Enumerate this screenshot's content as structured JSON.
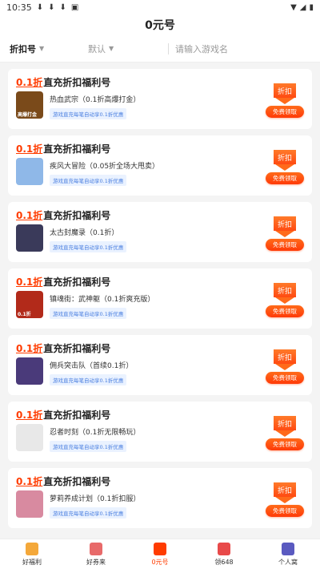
{
  "statusbar": {
    "time": "10:35"
  },
  "header": {
    "title": "0元号"
  },
  "filters": {
    "sort": "折扣号",
    "default": "默认",
    "search_placeholder": "请输入游戏名"
  },
  "card_common": {
    "disc": "0.1折",
    "title_rest": "直充折扣福利号",
    "tag": "游戏直充每笔自动享0.1折优惠",
    "badge": "折扣",
    "claim": "免费领取"
  },
  "cards": [
    {
      "name": "热血武宗（0.1折高爆打金）",
      "thumb_label": "高爆打金",
      "color": "#7a4a1a"
    },
    {
      "name": "疾风大冒险（0.05折全场大甩卖）",
      "thumb_label": "",
      "color": "#8fb8e8"
    },
    {
      "name": "太古封魔录（0.1折）",
      "thumb_label": "",
      "color": "#3a3a5a"
    },
    {
      "name": "镇魂街：武神躯（0.1折爽充版）",
      "thumb_label": "0.1折",
      "color": "#b22a1a"
    },
    {
      "name": "佣兵突击队（首续0.1折）",
      "thumb_label": "",
      "color": "#4a3a7a"
    },
    {
      "name": "忍者时刻（0.1折无限畅玩）",
      "thumb_label": "",
      "color": "#e8e8e8"
    },
    {
      "name": "萝莉养成计划（0.1折扣服）",
      "thumb_label": "",
      "color": "#d88aa0"
    }
  ],
  "tabbar": [
    {
      "label": "好福利",
      "color": "#f4a83a"
    },
    {
      "label": "好券来",
      "color": "#e86a6a"
    },
    {
      "label": "0元号",
      "color": "#ff3c00"
    },
    {
      "label": "领648",
      "color": "#e84a4a"
    },
    {
      "label": "个人窝",
      "color": "#5a5ac0"
    }
  ]
}
